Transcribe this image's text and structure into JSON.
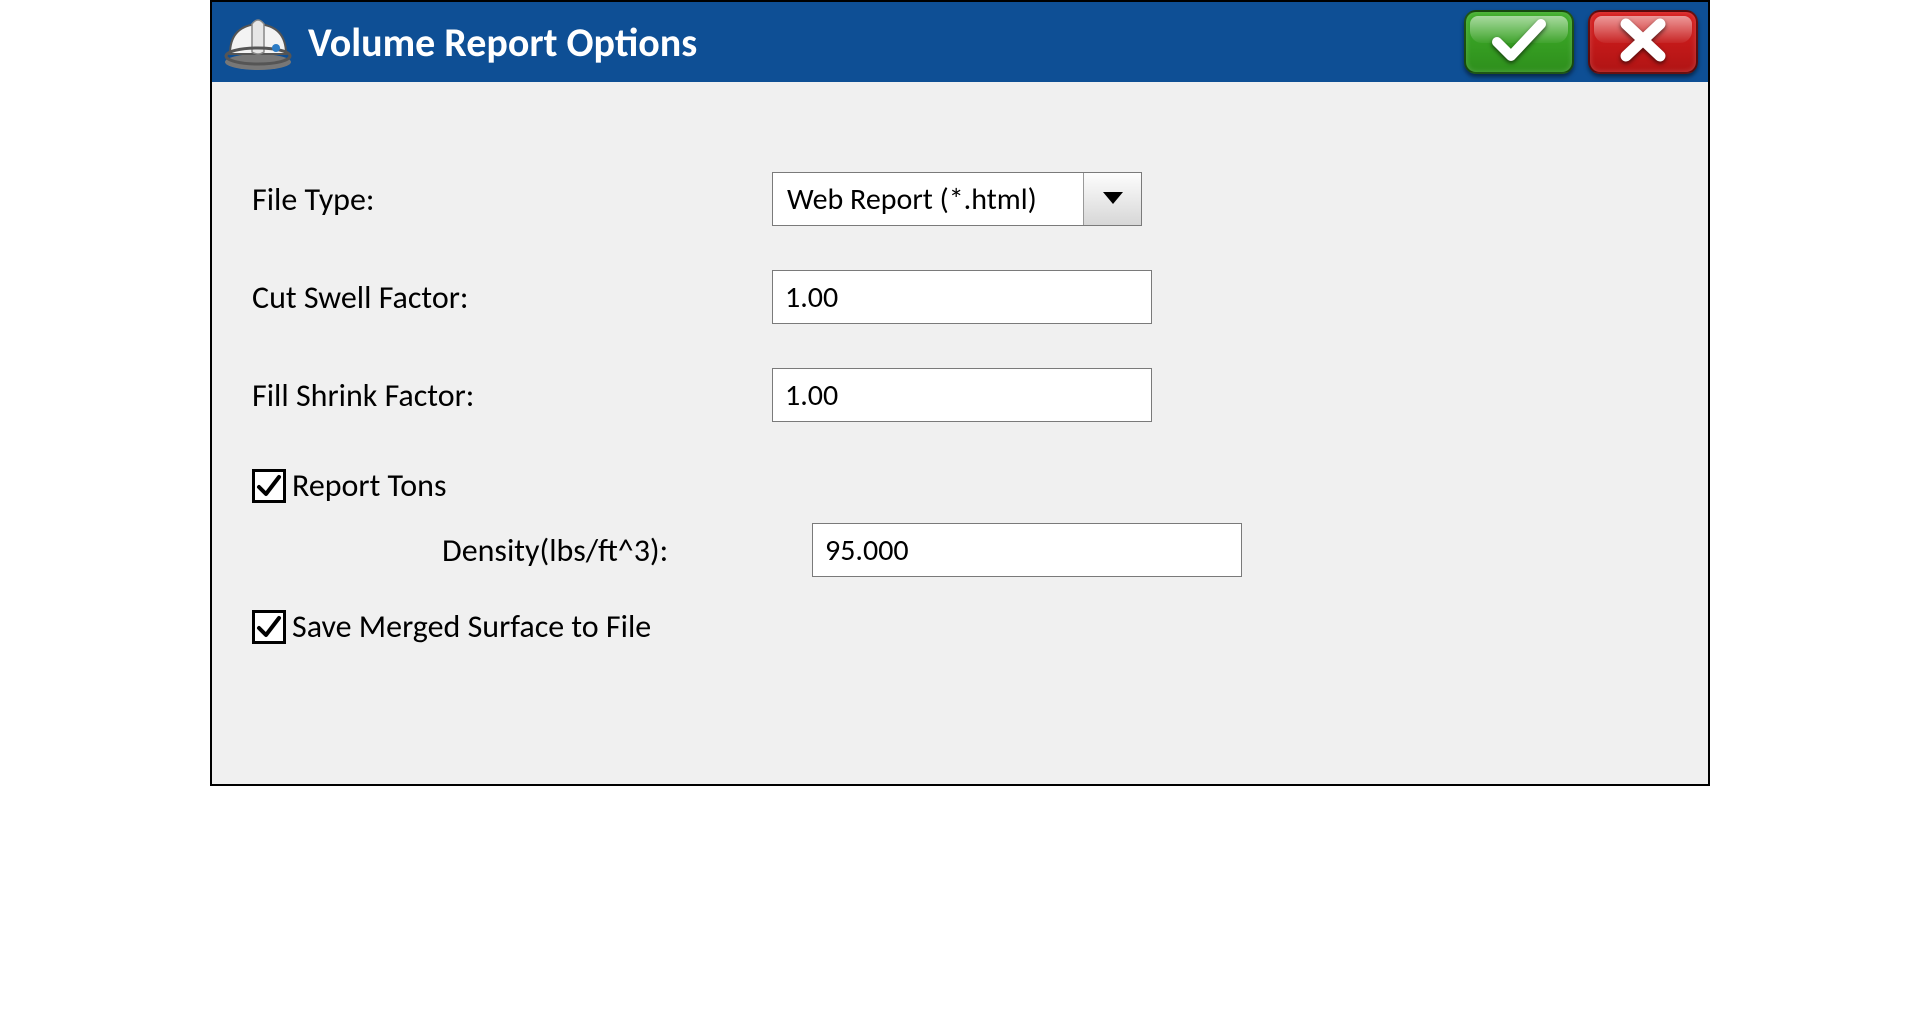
{
  "dialog": {
    "title": "Volume Report Options"
  },
  "form": {
    "file_type_label": "File Type:",
    "file_type_value": "Web Report (*.html)",
    "cut_swell_label": "Cut Swell Factor:",
    "cut_swell_value": "1.00",
    "fill_shrink_label": "Fill Shrink Factor:",
    "fill_shrink_value": "1.00",
    "report_tons_label": "Report Tons",
    "report_tons_checked": true,
    "density_label": "Density(lbs/ft^3):",
    "density_value": "95.000",
    "save_merged_label": "Save Merged Surface to File",
    "save_merged_checked": true
  }
}
